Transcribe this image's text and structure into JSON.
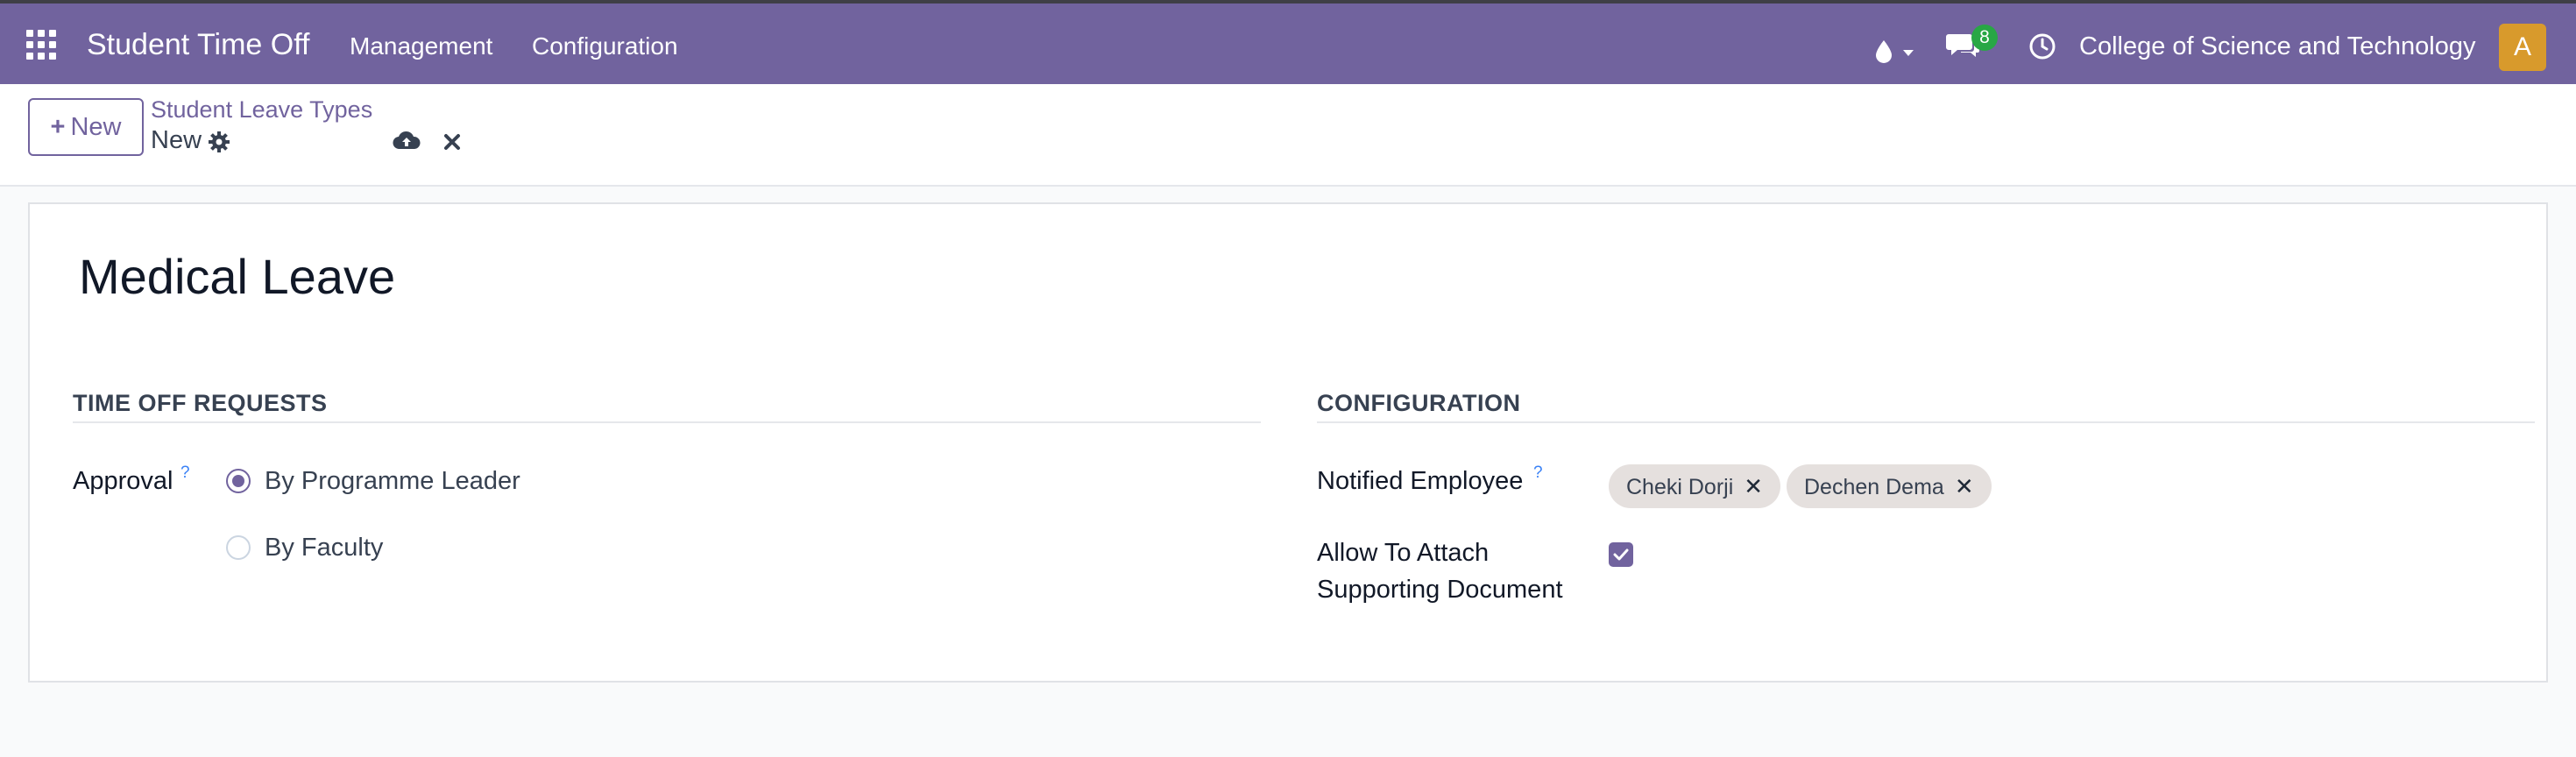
{
  "navbar": {
    "app_title": "Student Time Off",
    "menus": [
      "Management",
      "Configuration"
    ],
    "message_count": "8",
    "company": "College of Science and Technology",
    "avatar_initial": "A",
    "color": "#71639e"
  },
  "control_panel": {
    "new_button": "New",
    "breadcrumb_parent": "Student Leave Types",
    "breadcrumb_current": "New"
  },
  "form": {
    "record_name": "Medical Leave",
    "time_off_section": {
      "title": "TIME OFF REQUESTS",
      "approval_label": "Approval",
      "help": "?",
      "options": [
        {
          "label": "By Programme Leader",
          "selected": true
        },
        {
          "label": "By Faculty",
          "selected": false
        }
      ]
    },
    "configuration_section": {
      "title": "CONFIGURATION",
      "notified_label": "Notified Employee",
      "help": "?",
      "notified_tags": [
        "Cheki Dorji",
        "Dechen Dema"
      ],
      "attach_label_line1": "Allow To Attach",
      "attach_label_line2": "Supporting Document",
      "attach_checked": true
    }
  }
}
